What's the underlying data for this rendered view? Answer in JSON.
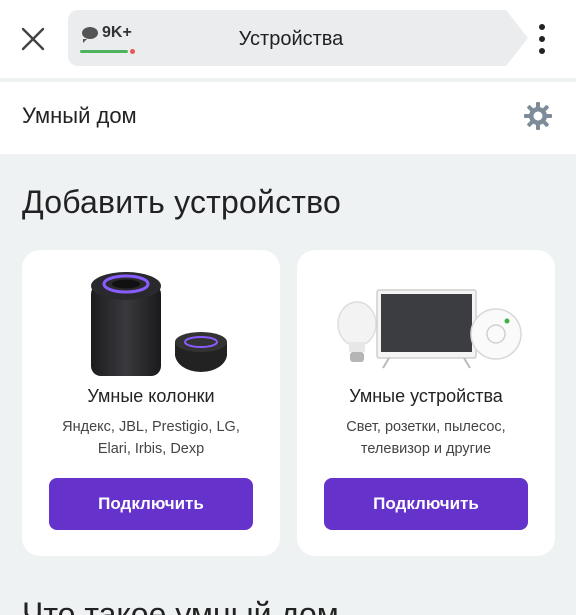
{
  "topbar": {
    "close_icon": "close-icon",
    "comments_count": "9K+",
    "title": "Устройства",
    "menu_icon": "kebab-menu-icon",
    "underline_color": "#4db35e"
  },
  "subheader": {
    "title": "Умный дом",
    "settings_icon": "gear-icon"
  },
  "section": {
    "title": "Добавить устройство"
  },
  "cards": [
    {
      "title": "Умные колонки",
      "desc_line1": "Яндекс, JBL, Prestigio, LG,",
      "desc_line2": "Elari, Irbis, Dexp",
      "button": "Подключить",
      "illustration": "smart-speakers-image"
    },
    {
      "title": "Умные устройства",
      "desc_line1": "Свет, розетки, пылесос,",
      "desc_line2": "телевизор и другие",
      "button": "Подключить",
      "illustration": "smart-devices-image"
    }
  ],
  "next_section": {
    "title": "Что такое умный дом"
  },
  "colors": {
    "accent": "#6632cc",
    "background": "#eef2f3"
  }
}
